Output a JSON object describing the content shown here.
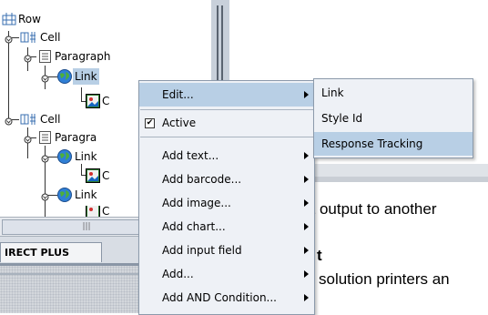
{
  "tree": {
    "nodes": [
      {
        "label": "Row",
        "icon": "row-icon"
      },
      {
        "label": "Cell",
        "icon": "cell-icon"
      },
      {
        "label": "Paragraph",
        "icon": "paragraph-icon"
      },
      {
        "label": "Link",
        "icon": "globe-link-icon"
      },
      {
        "label": "C",
        "icon": "image-icon"
      },
      {
        "label": "Cell",
        "icon": "cell-icon"
      },
      {
        "label": "Paragra",
        "icon": "paragraph-icon"
      },
      {
        "label": "Link",
        "icon": "globe-link-icon"
      },
      {
        "label": "C",
        "icon": "image-icon"
      },
      {
        "label": "Link",
        "icon": "globe-link-icon"
      },
      {
        "label": "C",
        "icon": "image-icon"
      }
    ],
    "scrollbar_grip": "|||"
  },
  "tab_label": "IRECT PLUS",
  "document_text": {
    "line1": "ct output to another",
    "line2": "t",
    "line3": "solution printers an"
  },
  "context_menu": {
    "items": [
      {
        "label": "Edit...",
        "submenu": true
      },
      {
        "label": "Active",
        "checked": true
      },
      {
        "label": "Add text...",
        "submenu": true
      },
      {
        "label": "Add barcode...",
        "submenu": true
      },
      {
        "label": "Add image...",
        "submenu": true
      },
      {
        "label": "Add chart...",
        "submenu": true
      },
      {
        "label": "Add input field",
        "submenu": true
      },
      {
        "label": "Add...",
        "submenu": true
      },
      {
        "label": "Add AND Condition...",
        "submenu": true
      }
    ]
  },
  "submenu": {
    "items": [
      {
        "label": "Link"
      },
      {
        "label": "Style Id"
      },
      {
        "label": "Response Tracking"
      }
    ]
  },
  "colors": {
    "selection": "#b8cfe5",
    "menu_background": "#eef1f6",
    "splitter": "#c8d0da"
  }
}
